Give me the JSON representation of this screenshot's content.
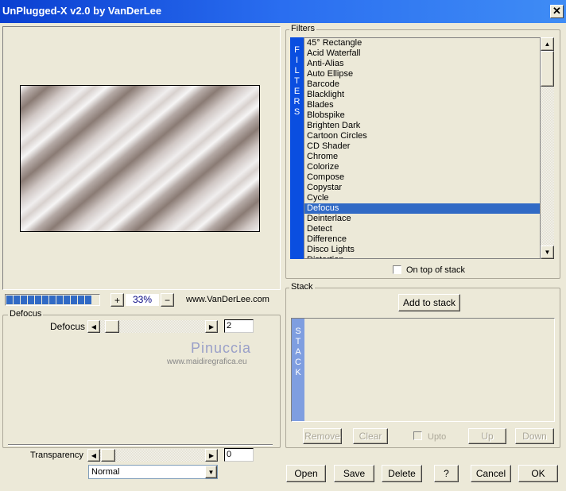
{
  "window": {
    "title": "UnPlugged-X v2.0 by VanDerLee",
    "close": "✕"
  },
  "preview": {
    "zoom": "33%",
    "zoom_in": "+",
    "zoom_out": "−",
    "website": "www.VanDerLee.com",
    "progress_segments": 12
  },
  "filter_settings": {
    "group": "Defocus",
    "param_label": "Defocus",
    "param_value": "2",
    "watermark_name": "Pinuccia",
    "watermark_url": "www.maidiregrafica.eu",
    "transparency_label": "Transparency",
    "transparency_value": "0",
    "blend_mode": "Normal"
  },
  "filters": {
    "group": "Filters",
    "strip": [
      "F",
      "I",
      "L",
      "T",
      "E",
      "R",
      "S"
    ],
    "items": [
      "45° Rectangle",
      "Acid Waterfall",
      "Anti-Alias",
      "Auto Ellipse",
      "Barcode",
      "Blacklight",
      "Blades",
      "Blobspike",
      "Brighten Dark",
      "Cartoon Circles",
      "CD Shader",
      "Chrome",
      "Colorize",
      "Compose",
      "Copystar",
      "Cycle",
      "Defocus",
      "Deinterlace",
      "Detect",
      "Difference",
      "Disco Lights",
      "Distortion"
    ],
    "selected": "Defocus",
    "on_top_label": "On top of stack"
  },
  "stack": {
    "group": "Stack",
    "add": "Add to stack",
    "strip": [
      "S",
      "T",
      "A",
      "C",
      "K"
    ],
    "remove": "Remove",
    "clear": "Clear",
    "upto": "Upto",
    "up": "Up",
    "down": "Down"
  },
  "footer": {
    "open": "Open",
    "save": "Save",
    "delete": "Delete",
    "help": "?",
    "cancel": "Cancel",
    "ok": "OK"
  },
  "colors": {
    "titlebar": "#0a3fd1",
    "selection": "#316ac5",
    "filters_strip": "#0a4ee0",
    "stack_strip": "#7f9ee0",
    "background": "#ece9d8"
  }
}
